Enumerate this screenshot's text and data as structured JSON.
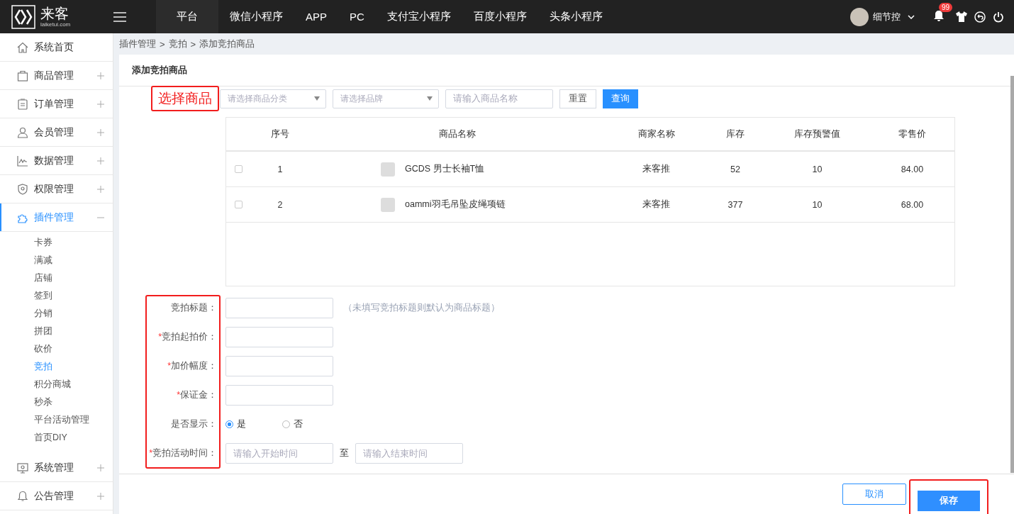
{
  "logo": {
    "name": "来客",
    "domain": "laiketui.com"
  },
  "top_nav": [
    {
      "label": "平台",
      "selected": true
    },
    {
      "label": "微信小程序",
      "selected": false
    },
    {
      "label": "APP",
      "selected": false
    },
    {
      "label": "PC",
      "selected": false
    },
    {
      "label": "支付宝小程序",
      "selected": false
    },
    {
      "label": "百度小程序",
      "selected": false
    },
    {
      "label": "头条小程序",
      "selected": false
    }
  ],
  "user": {
    "name": "细节控",
    "notification_count": "99"
  },
  "sidebar": [
    {
      "label": "系统首页",
      "expandable": false,
      "selected": false
    },
    {
      "label": "商品管理",
      "expandable": true,
      "expanded": false,
      "selected": false
    },
    {
      "label": "订单管理",
      "expandable": true,
      "expanded": false,
      "selected": false
    },
    {
      "label": "会员管理",
      "expandable": true,
      "expanded": false,
      "selected": false
    },
    {
      "label": "数据管理",
      "expandable": true,
      "expanded": false,
      "selected": false
    },
    {
      "label": "权限管理",
      "expandable": true,
      "expanded": false,
      "selected": false
    },
    {
      "label": "插件管理",
      "expandable": true,
      "expanded": true,
      "selected": true,
      "children": [
        {
          "label": "卡券",
          "selected": false
        },
        {
          "label": "满减",
          "selected": false
        },
        {
          "label": "店铺",
          "selected": false
        },
        {
          "label": "签到",
          "selected": false
        },
        {
          "label": "分销",
          "selected": false
        },
        {
          "label": "拼团",
          "selected": false
        },
        {
          "label": "砍价",
          "selected": false
        },
        {
          "label": "竞拍",
          "selected": true
        },
        {
          "label": "积分商城",
          "selected": false
        },
        {
          "label": "秒杀",
          "selected": false
        },
        {
          "label": "平台活动管理",
          "selected": false
        },
        {
          "label": "首页DIY",
          "selected": false
        }
      ]
    },
    {
      "label": "系统管理",
      "expandable": true,
      "expanded": false,
      "selected": false
    },
    {
      "label": "公告管理",
      "expandable": true,
      "expanded": false,
      "selected": false
    }
  ],
  "breadcrumb": [
    "插件管理",
    "竞拍",
    "添加竞拍商品"
  ],
  "breadcrumb_separator": ">",
  "card_title": "添加竞拍商品",
  "annotation_label": "选择商品",
  "filters": {
    "category_placeholder": "请选择商品分类",
    "brand_placeholder": "请选择品牌",
    "name_placeholder": "请输入商品名称",
    "reset": "重置",
    "search": "查询"
  },
  "table": {
    "columns": [
      "序号",
      "商品名称",
      "商家名称",
      "库存",
      "库存预警值",
      "零售价"
    ],
    "rows": [
      {
        "checked": false,
        "index": "1",
        "name": "GCDS 男士长袖T恤",
        "merchant": "来客推",
        "stock": "52",
        "warning": "10",
        "price": "84.00"
      },
      {
        "checked": false,
        "index": "2",
        "name": "oammi羽毛吊坠皮绳项链",
        "merchant": "来客推",
        "stock": "377",
        "warning": "10",
        "price": "68.00"
      }
    ]
  },
  "required_mark": "*",
  "form": [
    {
      "kind": "input",
      "label": "竞拍标题：",
      "required": false,
      "hint": "（未填写竞拍标题则默认为商品标题）"
    },
    {
      "kind": "input",
      "label": "竞拍起拍价：",
      "required": true
    },
    {
      "kind": "input",
      "label": "加价幅度：",
      "required": true
    },
    {
      "kind": "input",
      "label": "保证金：",
      "required": true
    },
    {
      "kind": "radio",
      "label": "是否显示：",
      "required": false,
      "options": [
        {
          "label": "是",
          "selected": true
        },
        {
          "label": "否",
          "selected": false
        }
      ]
    },
    {
      "kind": "range",
      "label": "竞拍活动时间：",
      "required": true,
      "start_placeholder": "请输入开始时间",
      "separator": "至",
      "end_placeholder": "请输入结束时间"
    }
  ],
  "buttons": {
    "cancel": "取消",
    "save": "保存"
  }
}
